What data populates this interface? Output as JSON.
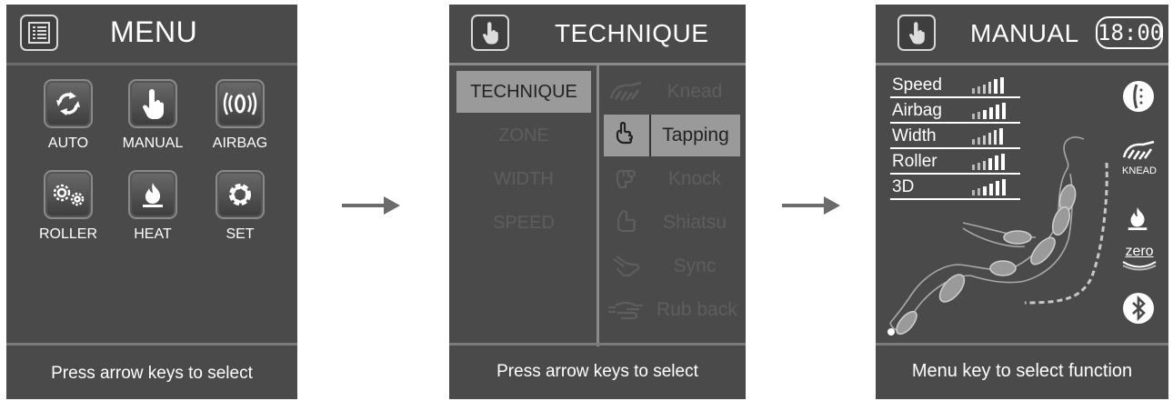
{
  "screens": {
    "menu": {
      "title": "MENU",
      "tiles": [
        {
          "label": "AUTO",
          "icon": "rotate-arrows-icon"
        },
        {
          "label": "MANUAL",
          "icon": "hand-pointer-icon"
        },
        {
          "label": "AIRBAG",
          "icon": "airbag-icon"
        },
        {
          "label": "ROLLER",
          "icon": "gears-icon"
        },
        {
          "label": "HEAT",
          "icon": "flame-icon"
        },
        {
          "label": "SET",
          "icon": "settings-gear-icon"
        }
      ],
      "footer": "Press arrow keys to select"
    },
    "technique": {
      "title": "TECHNIQUE",
      "categories": [
        "TECHNIQUE",
        "ZONE",
        "WIDTH",
        "SPEED"
      ],
      "selected_category": "TECHNIQUE",
      "techniques": [
        "Knead",
        "Tapping",
        "Knock",
        "Shiatsu",
        "Sync",
        "Rub back"
      ],
      "selected_technique": "Tapping",
      "footer": "Press arrow keys to select"
    },
    "manual": {
      "title": "MANUAL",
      "clock": "18:00",
      "params": [
        "Speed",
        "Airbag",
        "Width",
        "Roller",
        "3D"
      ],
      "knead_label": "KNEAD",
      "zero_label": "zero",
      "footer": "Menu key to select function"
    }
  },
  "colors": {
    "screen_bg": "#4a4a4a",
    "highlight": "#9a9a9a",
    "dim_text": "#5e5e5e",
    "arrow": "#6b6b6b"
  }
}
